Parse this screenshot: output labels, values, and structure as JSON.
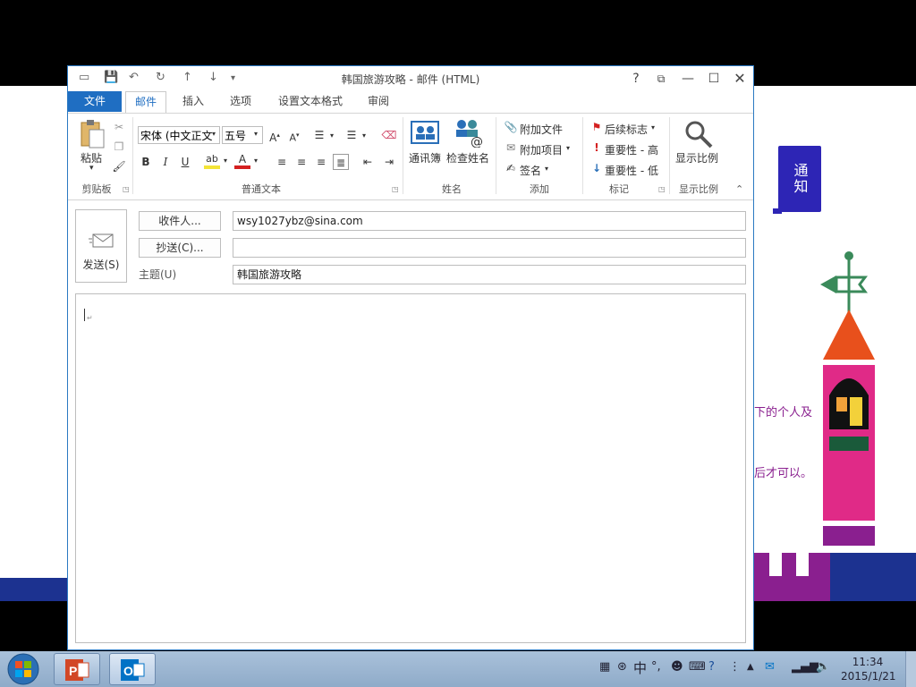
{
  "window": {
    "title": "韩国旅游攻略 - 邮件 (HTML)",
    "help_icon": "?",
    "controls": [
      "restore-ribbon-icon",
      "minimize-icon",
      "maximize-icon",
      "close-icon"
    ]
  },
  "tabs": [
    {
      "label": "文件"
    },
    {
      "label": "邮件"
    },
    {
      "label": "插入"
    },
    {
      "label": "选项"
    },
    {
      "label": "设置文本格式"
    },
    {
      "label": "审阅"
    }
  ],
  "ribbon": {
    "clipboard": {
      "paste": "粘贴",
      "group": "剪贴板"
    },
    "font": {
      "font_name": "宋体 (中文正文",
      "font_size": "五号",
      "group": "普通文本",
      "bold": "B",
      "italic": "I",
      "underline": "U"
    },
    "names": {
      "address_book": "通讯簿",
      "check_names": "检查姓名",
      "group": "姓名"
    },
    "include": {
      "attach_file": "附加文件",
      "attach_item": "附加项目",
      "signature": "签名",
      "group": "添加"
    },
    "tags": {
      "follow_up": "后续标志",
      "high": "重要性 - 高",
      "low": "重要性 - 低",
      "group": "标记"
    },
    "zoom": {
      "zoom": "显示比例",
      "group": "显示比例"
    }
  },
  "compose": {
    "send": "发送(S)",
    "to_button": "收件人...",
    "cc_button": "抄送(C)...",
    "subject_label": "主题(U)",
    "to_value": "wsy1027ybz@sina.com",
    "cc_value": "",
    "subject_value": "韩国旅游攻略"
  },
  "slide": {
    "notice": "通知",
    "line1": "下的个人及",
    "line2": "后才可以。"
  },
  "taskbar": {
    "time": "11:34",
    "date": "2015/1/21",
    "ime": "中"
  },
  "colors": {
    "accent": "#1f6ec2",
    "slide_purple": "#8a1f8f",
    "slide_blue": "#1c3290"
  }
}
